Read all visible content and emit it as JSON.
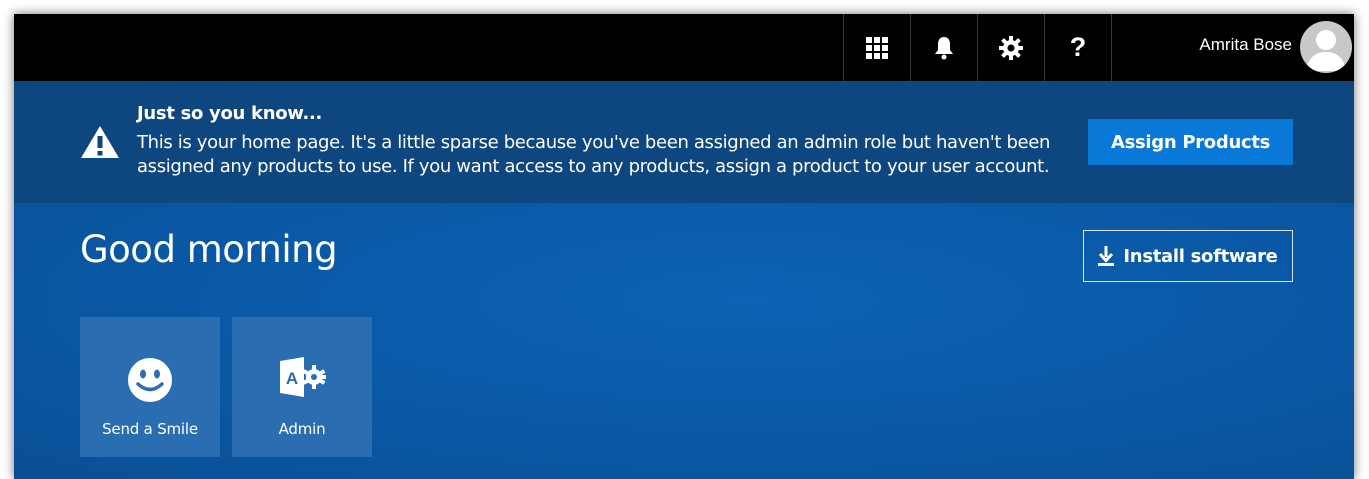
{
  "topbar": {
    "icons": [
      "app-launcher-icon",
      "bell-icon",
      "gear-icon",
      "help-icon"
    ],
    "user_name": "Amrita Bose"
  },
  "notice": {
    "title": "Just so you know...",
    "body": "This is your home page. It's a little sparse because you've been assigned an admin role but haven't been assigned any products to use. If you want access to any products, assign a product to your user account.",
    "button_label": "Assign Products"
  },
  "main": {
    "greeting": "Good morning",
    "install_label": "Install software",
    "tiles": [
      {
        "label": "Send a Smile",
        "icon": "smiley-icon"
      },
      {
        "label": "Admin",
        "icon": "admin-icon"
      }
    ]
  },
  "colors": {
    "topbar_bg": "#000000",
    "notice_bg": "#0e467f",
    "main_bg": "#0a5aa8",
    "accent_button": "#0a78d7",
    "tile_bg": "#2a6db1"
  }
}
